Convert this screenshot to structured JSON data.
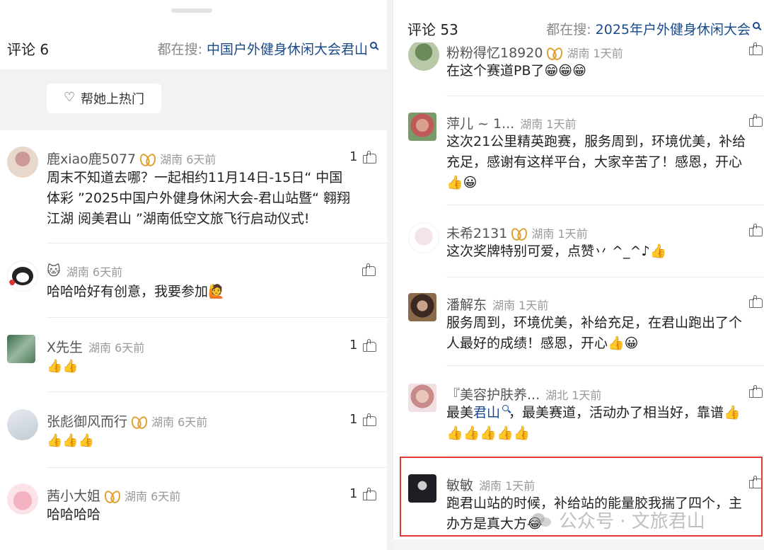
{
  "left": {
    "title": "评论 6",
    "search_label": "都在搜:",
    "search_query": "中国户外健身休闲大会君山",
    "hot_button": "帮她上热门",
    "comments": [
      {
        "user": "鹿xiao鹿5077",
        "loc": "湖南 6天前",
        "likes": "1",
        "text1": "周末不知道去哪？一起相约11月14日-15日“ 中国",
        "text2": "体彩 ”2025中国户外健身休闲大会-君山站暨“ 翱翔",
        "text3": "江湖 阅美君山 ”湖南低空文旅飞行启动仪式!"
      },
      {
        "user": "🐱",
        "loc": "湖南 6天前",
        "likes": "",
        "text1": "哈哈哈好有创意，我要参加🙋"
      },
      {
        "user": "X先生",
        "loc": "湖南 6天前",
        "likes": "1",
        "text1": "👍👍"
      },
      {
        "user": "张彪御风而行",
        "loc": "湖南 6天前",
        "likes": "1",
        "text1": "👍👍👍"
      },
      {
        "user": "茜小大姐",
        "loc": "湖南 6天前",
        "likes": "1",
        "text1": "哈哈哈哈"
      }
    ]
  },
  "right": {
    "title": "评论 53",
    "search_label": "都在搜:",
    "search_query": "2025年户外健身休闲大会",
    "comments": [
      {
        "user": "粉粉得忆18920",
        "loc": "湖南 1天前",
        "text1": "在这个赛道PB了😁😁😁"
      },
      {
        "user": "萍儿 ~ 1...",
        "loc": "湖南 1天前",
        "text1": "这次21公里精英跑赛，服务周到，环境优美，补给",
        "text2": "充足，感谢有这样平台，大家辛苦了！感恩，开心",
        "text3": "👍😀"
      },
      {
        "user": "未希2131",
        "loc": "湖南 1天前",
        "text1": "这次奖牌特别可爱，点赞丷 ^_^♪👍"
      },
      {
        "user": "潘解东",
        "loc": "湖南 1天前",
        "text1": "服务周到，环境优美，补给充足，在君山跑出了个",
        "text2": "人最好的成绩！感恩，开心👍😀"
      },
      {
        "user": "『美容护肤养...",
        "loc": "湖北 1天前",
        "text1_pre": "最美",
        "text1_link": "君山",
        "text1_post": "，最美赛道，活动办了相当好，靠谱👍",
        "text2": "👍👍👍👍👍"
      },
      {
        "user": "敏敏",
        "loc": "湖南 1天前",
        "text1": "跑君山站的时候，补给站的能量胶我揣了四个，主",
        "text2": "办方是真大方😂"
      }
    ]
  },
  "watermark": "公众号 · 文旅君山"
}
